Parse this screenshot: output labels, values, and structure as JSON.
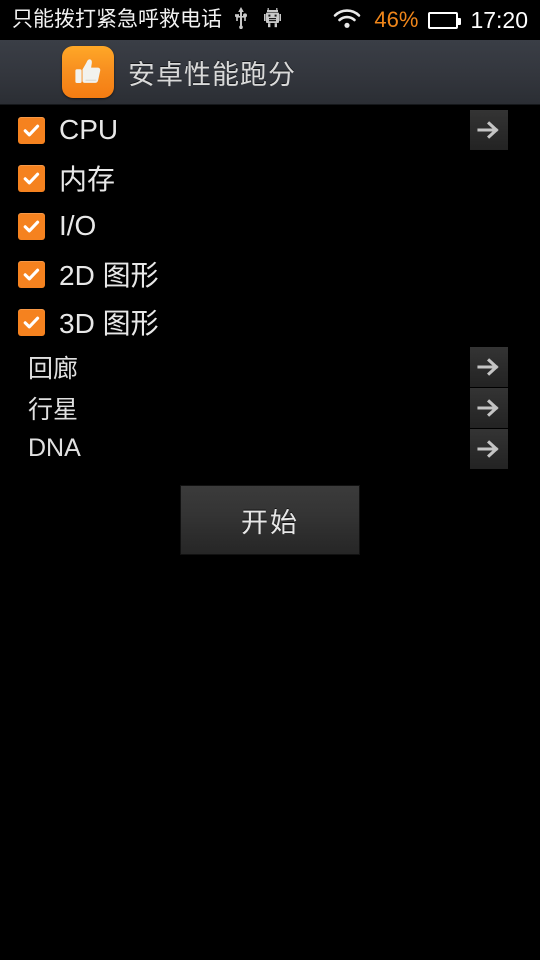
{
  "status_bar": {
    "carrier_text": "只能拨打紧急呼救电话",
    "usb_icon": "usb-icon",
    "robot_icon": "android-robot-icon",
    "wifi_icon": "wifi-icon",
    "battery_percent": "46%",
    "battery_icon": "battery-icon",
    "clock": "17:20",
    "battery_color": "#f0861a",
    "text_color": "#ffffff"
  },
  "app_header": {
    "icon_name": "thumbs-up-app-icon",
    "title": "安卓性能跑分",
    "accent_color": "#f5821f",
    "background_color": "#34373e"
  },
  "benchmarks": {
    "items": [
      {
        "label": "CPU",
        "checked": true,
        "has_arrow": true,
        "indent": "main"
      },
      {
        "label": "内存",
        "checked": true,
        "has_arrow": false,
        "indent": "main"
      },
      {
        "label": "I/O",
        "checked": true,
        "has_arrow": false,
        "indent": "main"
      },
      {
        "label": "2D 图形",
        "checked": true,
        "has_arrow": false,
        "indent": "main"
      },
      {
        "label": "3D 图形",
        "checked": true,
        "has_arrow": false,
        "indent": "main"
      },
      {
        "label": "回廊",
        "checked": null,
        "has_arrow": true,
        "indent": "sub"
      },
      {
        "label": "行星",
        "checked": null,
        "has_arrow": true,
        "indent": "sub"
      },
      {
        "label": "DNA",
        "checked": null,
        "has_arrow": true,
        "indent": "sub"
      }
    ],
    "checkbox_color": "#f5821f",
    "arrow_icon": "arrow-right-icon"
  },
  "start_button": {
    "label": "开始"
  }
}
